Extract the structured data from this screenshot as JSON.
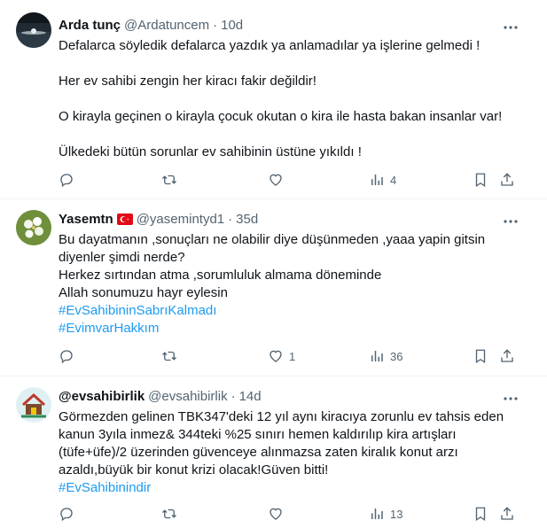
{
  "tweets": [
    {
      "name": "Arda tunç",
      "handle": "@Ardatuncem",
      "time": "10d",
      "avatar": "night-lake-avatar",
      "body": [
        "Defalarca söyledik defalarca yazdık ya anlamadılar  ya işlerine gelmedi !",
        "",
        "Her ev sahibi zengin her kiracı fakir değildir!",
        "",
        "O kirayla geçinen o kirayla çocuk okutan o kira ile hasta bakan insanlar var!",
        "",
        "Ülkedeki bütün sorunlar ev sahibinin üstüne yıkıldı !"
      ],
      "hashtags": [],
      "replies": "",
      "retweets": "",
      "likes": "",
      "views": "4"
    },
    {
      "name": "Yasemtn",
      "flag": "turkey-flag-icon",
      "handle": "@yasemintyd1",
      "time": "35d",
      "avatar": "jasmine-flower-avatar",
      "body": [
        "Bu dayatmanın ,sonuçları ne olabilir diye düşünmeden ,yaaa yapin gitsin",
        "diyenler şimdi nerde?",
        "Herkez sırtından atma ,sorumluluk almama döneminde",
        "Allah sonumuzu hayr eylesin"
      ],
      "hashtags": [
        "#EvSahibininSabrıKalmadı",
        "#EvimvarHakkım"
      ],
      "replies": "",
      "retweets": "",
      "likes": "1",
      "views": "36"
    },
    {
      "name": "@evsahibirlik",
      "handle": "@evsahibirlik",
      "time": "14d",
      "avatar": "house-logo-avatar",
      "body": [
        "Görmezden gelinen TBK347'deki 12 yıl aynı kiracıya zorunlu ev tahsis eden",
        "kanun 3yıla inmez& 344teki %25 sınırı hemen kaldırılıp kira artışları",
        "(tüfe+üfe)/2 üzerinden güvenceye alınmazsa zaten kiralık konut arzı",
        "azaldı,büyük bir konut krizi olacak!Güven bitti!"
      ],
      "hashtags": [
        "#EvSahibinindir"
      ],
      "replies": "",
      "retweets": "",
      "likes": "",
      "views": "13"
    }
  ],
  "separator": "·",
  "colors": {
    "text": "#0f1419",
    "muted": "#536471",
    "link": "#1d9bf0",
    "border": "#eff3f4"
  }
}
